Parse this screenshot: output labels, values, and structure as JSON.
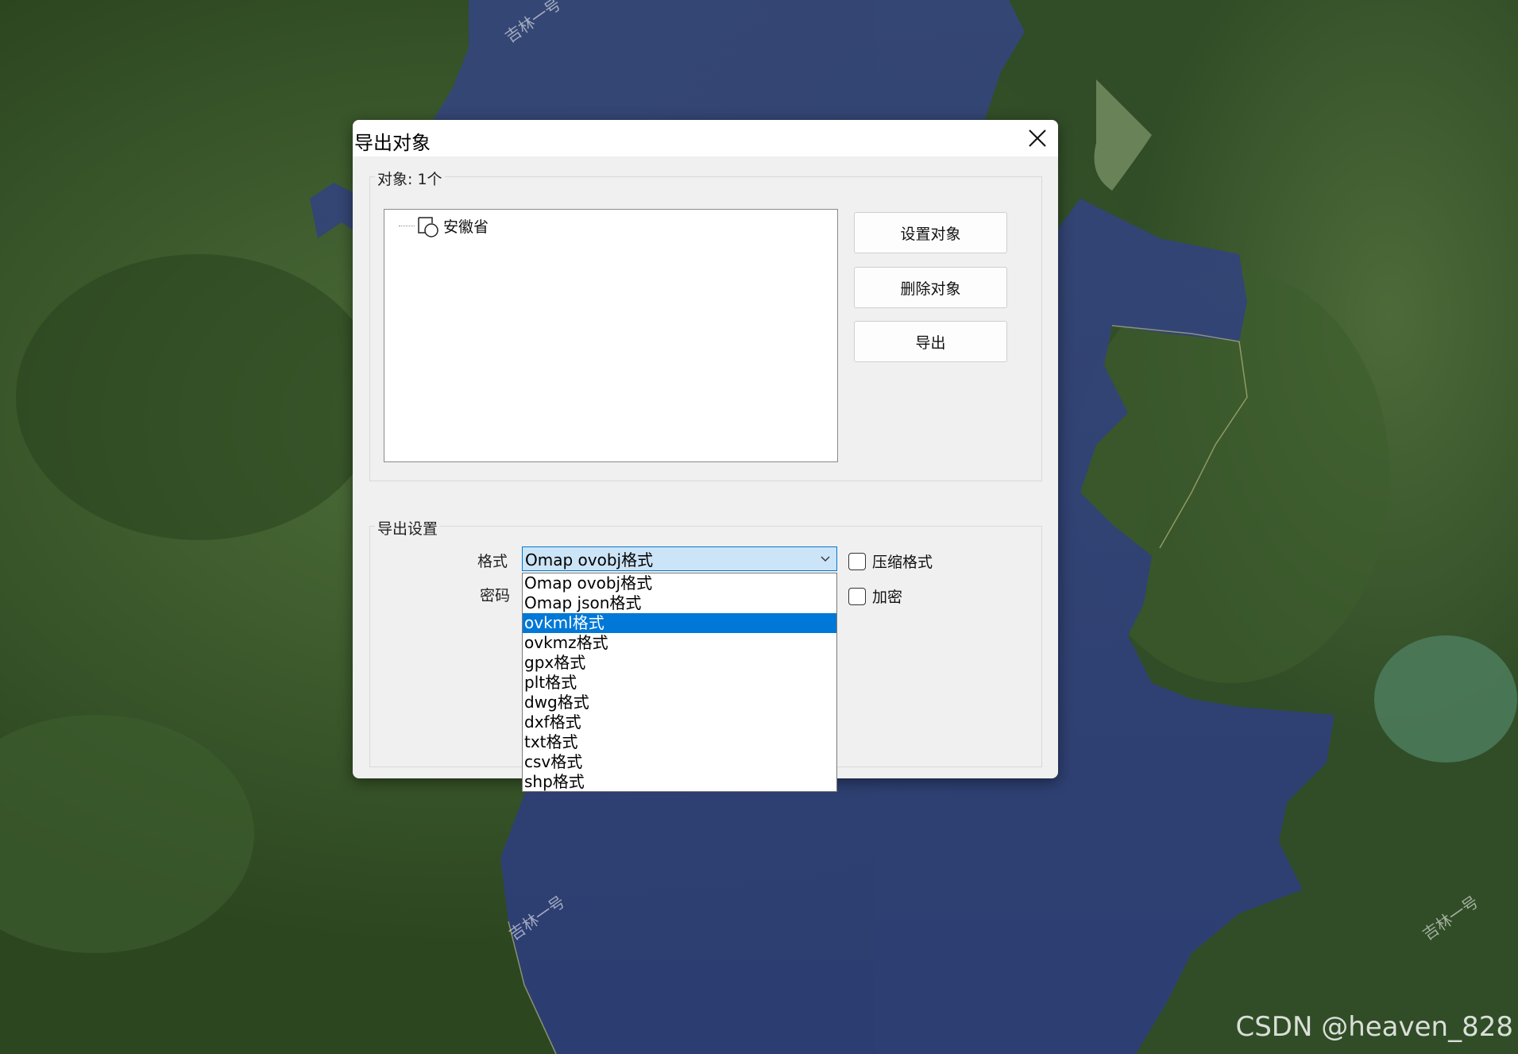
{
  "dialog": {
    "title": "导出对象",
    "objects_group_label": "对象: 1个",
    "tree_items": [
      {
        "label": "安徽省"
      }
    ],
    "buttons": {
      "set_objects": "设置对象",
      "delete_objects": "删除对象",
      "export": "导出"
    },
    "export_settings_label": "导出设置",
    "format_label": "格式",
    "password_label": "密码",
    "format_select": {
      "value": "Omap ovobj格式",
      "options": [
        "Omap ovobj格式",
        "Omap json格式",
        "ovkml格式",
        "ovkmz格式",
        "gpx格式",
        "plt格式",
        "dwg格式",
        "dxf格式",
        "txt格式",
        "csv格式",
        "shp格式"
      ],
      "highlighted_index": 2
    },
    "compress_label": "压缩格式",
    "encrypt_label": "加密"
  },
  "watermarks": [
    "吉林一号",
    "吉林一号",
    "吉林一号"
  ],
  "csdn_watermark": "CSDN @heaven_828",
  "colors": {
    "selection": "#0078d7",
    "select_bg": "#cce4f7",
    "select_border": "#0078d4"
  }
}
